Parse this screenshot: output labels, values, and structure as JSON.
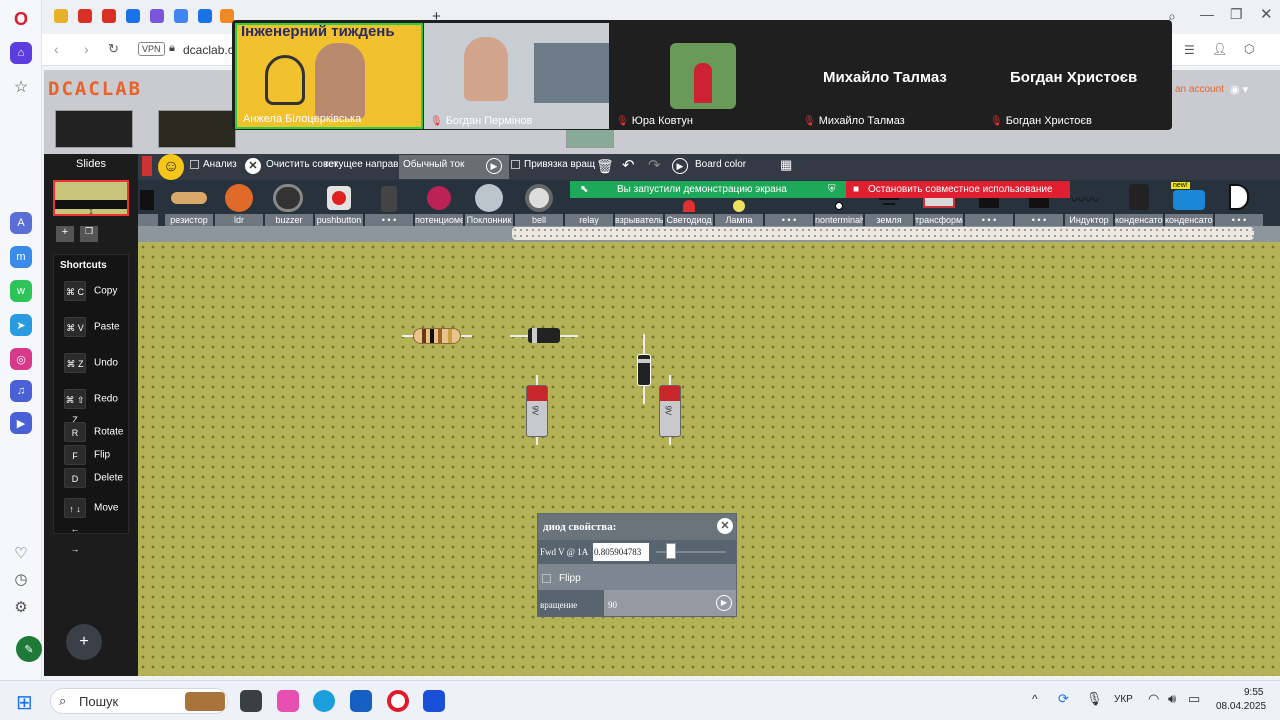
{
  "browser": {
    "url": "dcaclab.c",
    "vpn": "VPN",
    "account": "an account"
  },
  "site": {
    "logo": "DCACLAB"
  },
  "video": {
    "banner": "Інженерний тиждень",
    "participants": [
      "Анжела Білоцерківська",
      "Богдан Пермінов",
      "Юра Ковтун",
      "Михайло Талмаз",
      "Богдан Христоєв"
    ],
    "big_names": [
      "Михайло Талмаз",
      "Богдан Христоєв"
    ]
  },
  "slides": {
    "title": "Slides",
    "slide_number": "1"
  },
  "shortcuts": {
    "title": "Shortcuts",
    "items": [
      {
        "keys": "⌘ C",
        "label": "Copy"
      },
      {
        "keys": "⌘ V",
        "label": "Paste"
      },
      {
        "keys": "⌘ Z",
        "label": "Undo"
      },
      {
        "keys": "⌘ ⇧ Z",
        "label": "Redo"
      },
      {
        "keys": "R",
        "label": "Rotate"
      },
      {
        "keys": "F",
        "label": "Flip"
      },
      {
        "keys": "D",
        "label": "Delete"
      },
      {
        "keys": "↑ ↓ ← →",
        "label": "Move"
      }
    ]
  },
  "toolbar": {
    "analysis": "Анализ",
    "clear": "Очистить совет",
    "current_dir": "текущее направ",
    "normal_current": "Обычный ток",
    "snap": "Привязка вращ",
    "board_color": "Board color"
  },
  "screen_share": {
    "notice": "Вы запустили демонстрацию экрана",
    "stop": "Остановить совместное использование"
  },
  "parts": [
    "",
    "резистор",
    "ldr",
    "buzzer",
    "pushbutton",
    "• • •",
    "потенциомет",
    "Поклонник",
    "bell",
    "relay",
    "взрыватель",
    "Светодиод",
    "Лампа",
    "• • •",
    "nonterminalv",
    "земля",
    "трансформат",
    "• • •",
    "• • •",
    "Индуктор",
    "конденсатор",
    "конденсатор",
    "• • •"
  ],
  "new_badge": "new!",
  "properties": {
    "title": "диод свойства:",
    "fwd_label": "Fwd V @ 1A",
    "fwd_value": "0.805904783",
    "flip": "Flipp",
    "rotation_label": "вращение",
    "rotation_value": "90"
  },
  "components": {
    "battery_label": "9V"
  },
  "taskbar": {
    "search": "Пошук",
    "lang": "УКР",
    "time": "9:55",
    "date": "08.04.2025"
  },
  "colors": {
    "board": "#b3b257",
    "toolbar": "#333a44",
    "accent": "#e8622a",
    "share_green": "#1ea85a",
    "stop_red": "#e02030"
  }
}
